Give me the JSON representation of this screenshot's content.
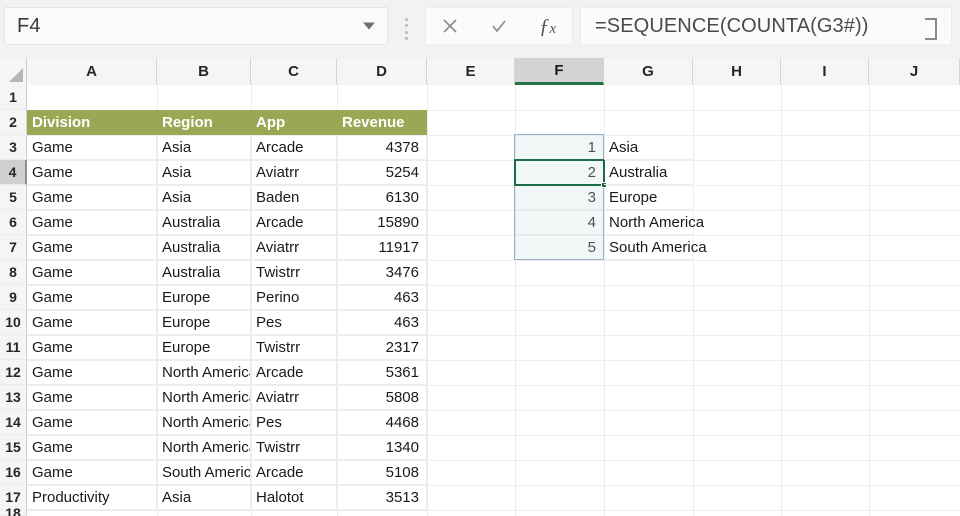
{
  "app": "excel-spreadsheet",
  "namebox": {
    "value": "F4",
    "dropdown_icon": "chevron-down-icon"
  },
  "formula_bar": {
    "cancel_icon": "close-icon",
    "confirm_icon": "check-icon",
    "insert_function_icon": "fx-icon",
    "formula": "=SEQUENCE(COUNTA(G3#))",
    "expand_icon": "expand-formula-bar-icon"
  },
  "grid": {
    "column_headers": [
      "A",
      "B",
      "C",
      "D",
      "E",
      "F",
      "G",
      "H",
      "I",
      "J"
    ],
    "selected_column": "F",
    "row_headers": [
      "1",
      "2",
      "3",
      "4",
      "5",
      "6",
      "7",
      "8",
      "9",
      "10",
      "11",
      "12",
      "13",
      "14",
      "15",
      "16",
      "17",
      "18"
    ],
    "selected_row": "4",
    "active_cell": "F4",
    "spill_range": "F3:F7",
    "table_header": {
      "A": "Division",
      "B": "Region",
      "C": "App",
      "D": "Revenue"
    },
    "header_fill_color": "#9aa855",
    "header_text_color": "#ffffff",
    "rows": [
      {
        "row": "3",
        "division": "Game",
        "region": "Asia",
        "app": "Arcade",
        "revenue": "4378"
      },
      {
        "row": "4",
        "division": "Game",
        "region": "Asia",
        "app": "Aviatrr",
        "revenue": "5254"
      },
      {
        "row": "5",
        "division": "Game",
        "region": "Asia",
        "app": "Baden",
        "revenue": "6130"
      },
      {
        "row": "6",
        "division": "Game",
        "region": "Australia",
        "app": "Arcade",
        "revenue": "15890"
      },
      {
        "row": "7",
        "division": "Game",
        "region": "Australia",
        "app": "Aviatrr",
        "revenue": "11917"
      },
      {
        "row": "8",
        "division": "Game",
        "region": "Australia",
        "app": "Twistrr",
        "revenue": "3476"
      },
      {
        "row": "9",
        "division": "Game",
        "region": "Europe",
        "app": "Perino",
        "revenue": "463"
      },
      {
        "row": "10",
        "division": "Game",
        "region": "Europe",
        "app": "Pes",
        "revenue": "463"
      },
      {
        "row": "11",
        "division": "Game",
        "region": "Europe",
        "app": "Twistrr",
        "revenue": "2317"
      },
      {
        "row": "12",
        "division": "Game",
        "region": "North America",
        "app": "Arcade",
        "revenue": "5361"
      },
      {
        "row": "13",
        "division": "Game",
        "region": "North America",
        "app": "Aviatrr",
        "revenue": "5808"
      },
      {
        "row": "14",
        "division": "Game",
        "region": "North America",
        "app": "Pes",
        "revenue": "4468"
      },
      {
        "row": "15",
        "division": "Game",
        "region": "North America",
        "app": "Twistrr",
        "revenue": "1340"
      },
      {
        "row": "16",
        "division": "Game",
        "region": "South America",
        "app": "Arcade",
        "revenue": "5108"
      },
      {
        "row": "17",
        "division": "Productivity",
        "region": "Asia",
        "app": "Halotot",
        "revenue": "3513"
      }
    ],
    "spill_result": [
      {
        "row": "3",
        "f": "1",
        "g": "Asia"
      },
      {
        "row": "4",
        "f": "2",
        "g": "Australia"
      },
      {
        "row": "5",
        "f": "3",
        "g": "Europe"
      },
      {
        "row": "6",
        "f": "4",
        "g": "North America"
      },
      {
        "row": "7",
        "f": "5",
        "g": "South America"
      }
    ]
  },
  "colors": {
    "accent_green": "#217346",
    "active_cell_border": "#1d6b48",
    "spill_border": "#9bb0c4",
    "header_band": "#f5f5f5"
  }
}
